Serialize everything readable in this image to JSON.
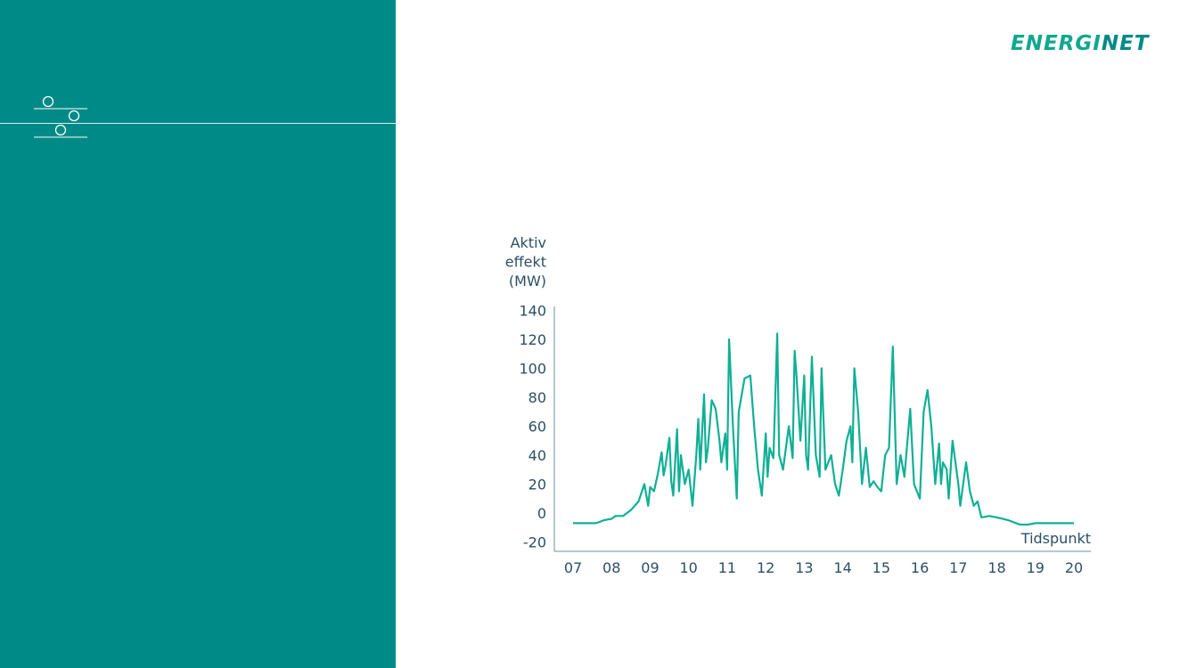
{
  "brand": {
    "logo_part1": "ENERGI",
    "logo_part2": "NET"
  },
  "colors": {
    "panel": "#008a87",
    "line": "#0fb095",
    "text": "#2b4f66",
    "axis": "#6f8f9c"
  },
  "chart_data": {
    "type": "line",
    "ylabel": [
      "Aktiv",
      "effekt",
      "(MW)"
    ],
    "xlabel": "Tidspunkt",
    "ylim": [
      -20,
      140
    ],
    "yticks": [
      -20,
      0,
      20,
      40,
      60,
      80,
      100,
      120,
      140
    ],
    "xticks": [
      "07",
      "08",
      "09",
      "10",
      "11",
      "12",
      "13",
      "14",
      "15",
      "16",
      "17",
      "18",
      "19",
      "20"
    ],
    "grid": false,
    "series": [
      {
        "values": [
          [
            7.0,
            -7
          ],
          [
            7.3,
            -7
          ],
          [
            7.6,
            -7
          ],
          [
            7.8,
            -5
          ],
          [
            8.0,
            -4
          ],
          [
            8.1,
            -2
          ],
          [
            8.3,
            -2
          ],
          [
            8.5,
            2
          ],
          [
            8.7,
            8
          ],
          [
            8.85,
            20
          ],
          [
            8.95,
            5
          ],
          [
            9.0,
            18
          ],
          [
            9.1,
            15
          ],
          [
            9.2,
            27
          ],
          [
            9.3,
            42
          ],
          [
            9.35,
            26
          ],
          [
            9.4,
            33
          ],
          [
            9.5,
            52
          ],
          [
            9.55,
            22
          ],
          [
            9.6,
            12
          ],
          [
            9.7,
            58
          ],
          [
            9.75,
            15
          ],
          [
            9.8,
            40
          ],
          [
            9.9,
            20
          ],
          [
            10.0,
            30
          ],
          [
            10.1,
            5
          ],
          [
            10.2,
            40
          ],
          [
            10.25,
            65
          ],
          [
            10.3,
            30
          ],
          [
            10.4,
            82
          ],
          [
            10.45,
            35
          ],
          [
            10.5,
            45
          ],
          [
            10.6,
            78
          ],
          [
            10.7,
            72
          ],
          [
            10.8,
            50
          ],
          [
            10.85,
            35
          ],
          [
            10.95,
            55
          ],
          [
            11.0,
            30
          ],
          [
            11.05,
            120
          ],
          [
            11.15,
            60
          ],
          [
            11.25,
            10
          ],
          [
            11.3,
            70
          ],
          [
            11.45,
            93
          ],
          [
            11.6,
            95
          ],
          [
            11.7,
            60
          ],
          [
            11.8,
            30
          ],
          [
            11.9,
            12
          ],
          [
            12.0,
            55
          ],
          [
            12.05,
            25
          ],
          [
            12.1,
            45
          ],
          [
            12.2,
            38
          ],
          [
            12.3,
            124
          ],
          [
            12.35,
            40
          ],
          [
            12.45,
            30
          ],
          [
            12.6,
            60
          ],
          [
            12.7,
            38
          ],
          [
            12.75,
            112
          ],
          [
            12.8,
            95
          ],
          [
            12.9,
            50
          ],
          [
            13.0,
            95
          ],
          [
            13.05,
            40
          ],
          [
            13.1,
            30
          ],
          [
            13.2,
            108
          ],
          [
            13.3,
            40
          ],
          [
            13.4,
            25
          ],
          [
            13.45,
            100
          ],
          [
            13.55,
            30
          ],
          [
            13.7,
            40
          ],
          [
            13.8,
            20
          ],
          [
            13.9,
            12
          ],
          [
            14.0,
            30
          ],
          [
            14.1,
            50
          ],
          [
            14.2,
            60
          ],
          [
            14.25,
            35
          ],
          [
            14.3,
            100
          ],
          [
            14.4,
            70
          ],
          [
            14.5,
            20
          ],
          [
            14.6,
            45
          ],
          [
            14.7,
            18
          ],
          [
            14.8,
            22
          ],
          [
            14.9,
            18
          ],
          [
            15.0,
            15
          ],
          [
            15.1,
            40
          ],
          [
            15.2,
            45
          ],
          [
            15.3,
            115
          ],
          [
            15.4,
            20
          ],
          [
            15.5,
            40
          ],
          [
            15.6,
            25
          ],
          [
            15.75,
            72
          ],
          [
            15.85,
            20
          ],
          [
            16.0,
            10
          ],
          [
            16.1,
            70
          ],
          [
            16.2,
            85
          ],
          [
            16.3,
            60
          ],
          [
            16.4,
            20
          ],
          [
            16.5,
            48
          ],
          [
            16.55,
            20
          ],
          [
            16.6,
            35
          ],
          [
            16.7,
            30
          ],
          [
            16.75,
            10
          ],
          [
            16.85,
            50
          ],
          [
            17.0,
            20
          ],
          [
            17.05,
            5
          ],
          [
            17.2,
            35
          ],
          [
            17.3,
            15
          ],
          [
            17.4,
            5
          ],
          [
            17.5,
            8
          ],
          [
            17.6,
            -3
          ],
          [
            17.8,
            -2
          ],
          [
            18.0,
            -3
          ],
          [
            18.3,
            -5
          ],
          [
            18.6,
            -8
          ],
          [
            18.8,
            -8
          ],
          [
            19.0,
            -7
          ],
          [
            19.2,
            -7
          ],
          [
            19.5,
            -7
          ],
          [
            19.8,
            -7
          ],
          [
            20.0,
            -7
          ]
        ]
      }
    ]
  }
}
